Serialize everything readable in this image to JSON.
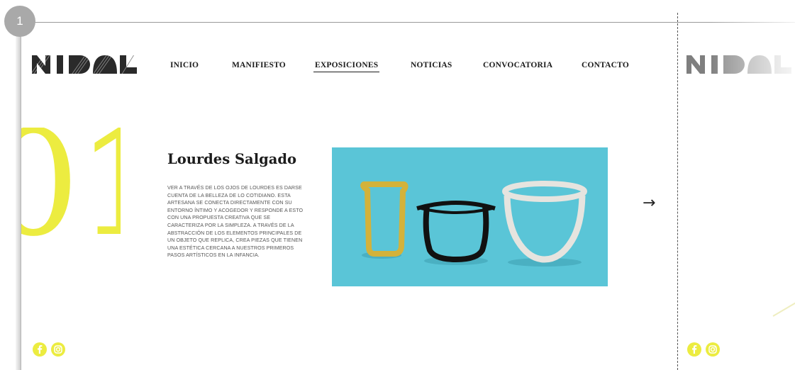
{
  "step_badge": "1",
  "brand": {
    "logo_text": "NIDAL"
  },
  "nav": {
    "items": [
      {
        "label": "INICIO"
      },
      {
        "label": "MANIFIESTO"
      },
      {
        "label": "EXPOSICIONES",
        "active": true
      },
      {
        "label": "NOTICIAS"
      },
      {
        "label": "CONVOCATORIA"
      },
      {
        "label": "CONTACTO"
      }
    ]
  },
  "exhibition": {
    "number": "01",
    "artist_name": "Lourdes Salgado",
    "description": "VER A TRAVÉS DE LOS OJOS DE LOURDES ES DARSE CUENTA DE LA BELLEZA DE LO COTIDIANO. ESTA ARTESANA SE CONECTA DIRECTAMENTE CON SU ENTORNO ÍNTIMO Y ACOGEDOR Y RESPONDE A ESTO CON UNA PROPUESTA CREATIVA QUE SE CARACTERIZA POR LA SIMPLEZA. A TRAVÉS DE LA ABSTRACCIÓN DE LOS ELEMENTOS PRINCIPALES DE UN OBJETO QUE REPLICA, CREA PIEZAS QUE TIENEN UNA ESTÉTICA CERCANA A NUESTROS PRIMEROS PASOS ARTÍSTICOS EN LA INFANCIA.",
    "next_arrow": "→"
  },
  "social": {
    "icons": [
      "facebook-icon",
      "instagram-icon"
    ]
  },
  "colors": {
    "accent_yellow": "#ecec40",
    "artwork_bg": "#5ac5d7",
    "text_dark": "#1b1b1b",
    "badge_gray": "#a9a9a9"
  }
}
